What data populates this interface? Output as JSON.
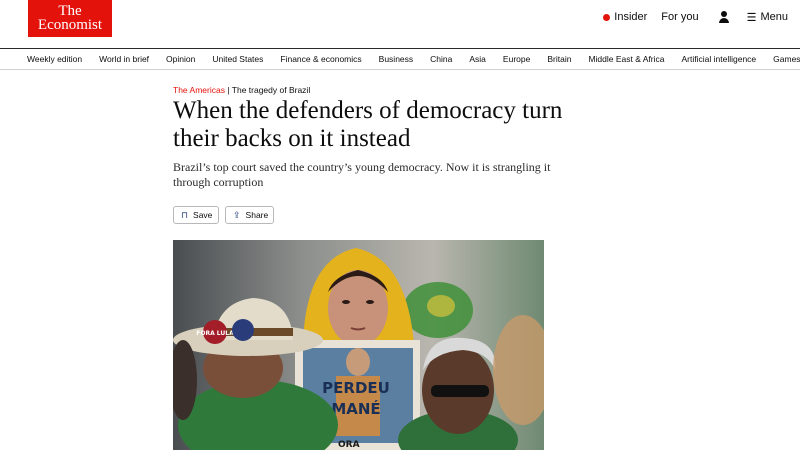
{
  "brand": {
    "logo_line1": "The",
    "logo_line2": "Economist",
    "accent": "#e3120b"
  },
  "header": {
    "insider_label": "Insider",
    "foryou_label": "For you",
    "user_icon": "user-icon",
    "menu_icon": "menu-icon",
    "menu_label": "Menu"
  },
  "nav": {
    "items": [
      "Weekly edition",
      "World in brief",
      "Opinion",
      "United States",
      "Finance & economics",
      "Business",
      "China",
      "Asia",
      "Europe",
      "Britain",
      "Middle East & Africa",
      "Artificial intelligence",
      "Games"
    ]
  },
  "article": {
    "section": "The Americas",
    "separator": "|",
    "rubric": "The tragedy of Brazil",
    "headline": "When the defenders of democracy turn their backs on it instead",
    "subheadline": "Brazil’s top court saved the country’s young democracy. Now it is strangling it through corruption",
    "save_label": "Save",
    "share_label": "Share",
    "image": {
      "sign_text_1": "PERDEU",
      "sign_text_2": "MANÉ",
      "badge_text": "FORA LULA",
      "placard_fragment": "ORA"
    }
  }
}
